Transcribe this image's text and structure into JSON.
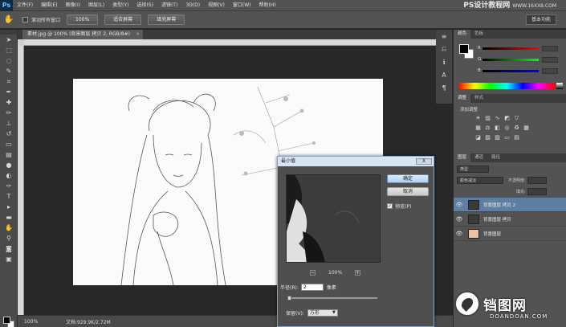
{
  "app": {
    "logo": "Ps",
    "brand": "PS设计教程网",
    "brand_url": "WWW.16XX8.COM"
  },
  "menu": [
    "文件(F)",
    "编辑(E)",
    "图像(I)",
    "图层(L)",
    "类型(Y)",
    "选择(S)",
    "滤镜(T)",
    "3D(D)",
    "视图(V)",
    "窗口(W)",
    "帮助(H)"
  ],
  "options": {
    "checkbox_label": "滚动所有窗口",
    "buttons": [
      "100%",
      "适合屏幕",
      "填充屏幕"
    ],
    "workspace": "基本功能"
  },
  "document": {
    "tab_title": "素材.jpg @ 100% (背景图层 拷贝 2, RGB/8#)",
    "tab_close": "×",
    "zoom": "100%",
    "doc_info": "文档:929.9K/2.72M"
  },
  "panels": {
    "color_tabs": [
      "颜色",
      "色板"
    ],
    "slider_labels": [
      "R",
      "G",
      "B"
    ],
    "adj_tabs": [
      "调整",
      "样式"
    ],
    "adj_title": "添加调整",
    "layers_tabs": [
      "图层",
      "通道",
      "路径"
    ],
    "layers_kind": "类型",
    "blend_mode": "颜色减淡",
    "opacity_label": "不透明度:",
    "fill_label": "填充:",
    "layers": [
      {
        "name": "背景图层 拷贝 2",
        "selected": true,
        "thumb": "dark"
      },
      {
        "name": "背景图层 拷贝",
        "selected": false,
        "thumb": "dark"
      },
      {
        "name": "背景图层",
        "selected": false,
        "thumb": "skin"
      }
    ]
  },
  "dialog": {
    "title": "最小值",
    "close": "X",
    "ok": "确定",
    "cancel": "取消",
    "preview_label": "预览(P)",
    "preview_checked": "✓",
    "zoom_out": "−",
    "zoom_value": "100%",
    "zoom_in": "+",
    "radius_label": "半径(R):",
    "radius_value": "2",
    "radius_unit": "像素",
    "keep_label": "保留(V):",
    "keep_value": "方形"
  },
  "watermark": {
    "text": "铛图网",
    "sub": "DOANDOAN.COM"
  },
  "colors": {
    "accent": "#5f7fa2",
    "dialog_title": "#d7e4f1"
  }
}
